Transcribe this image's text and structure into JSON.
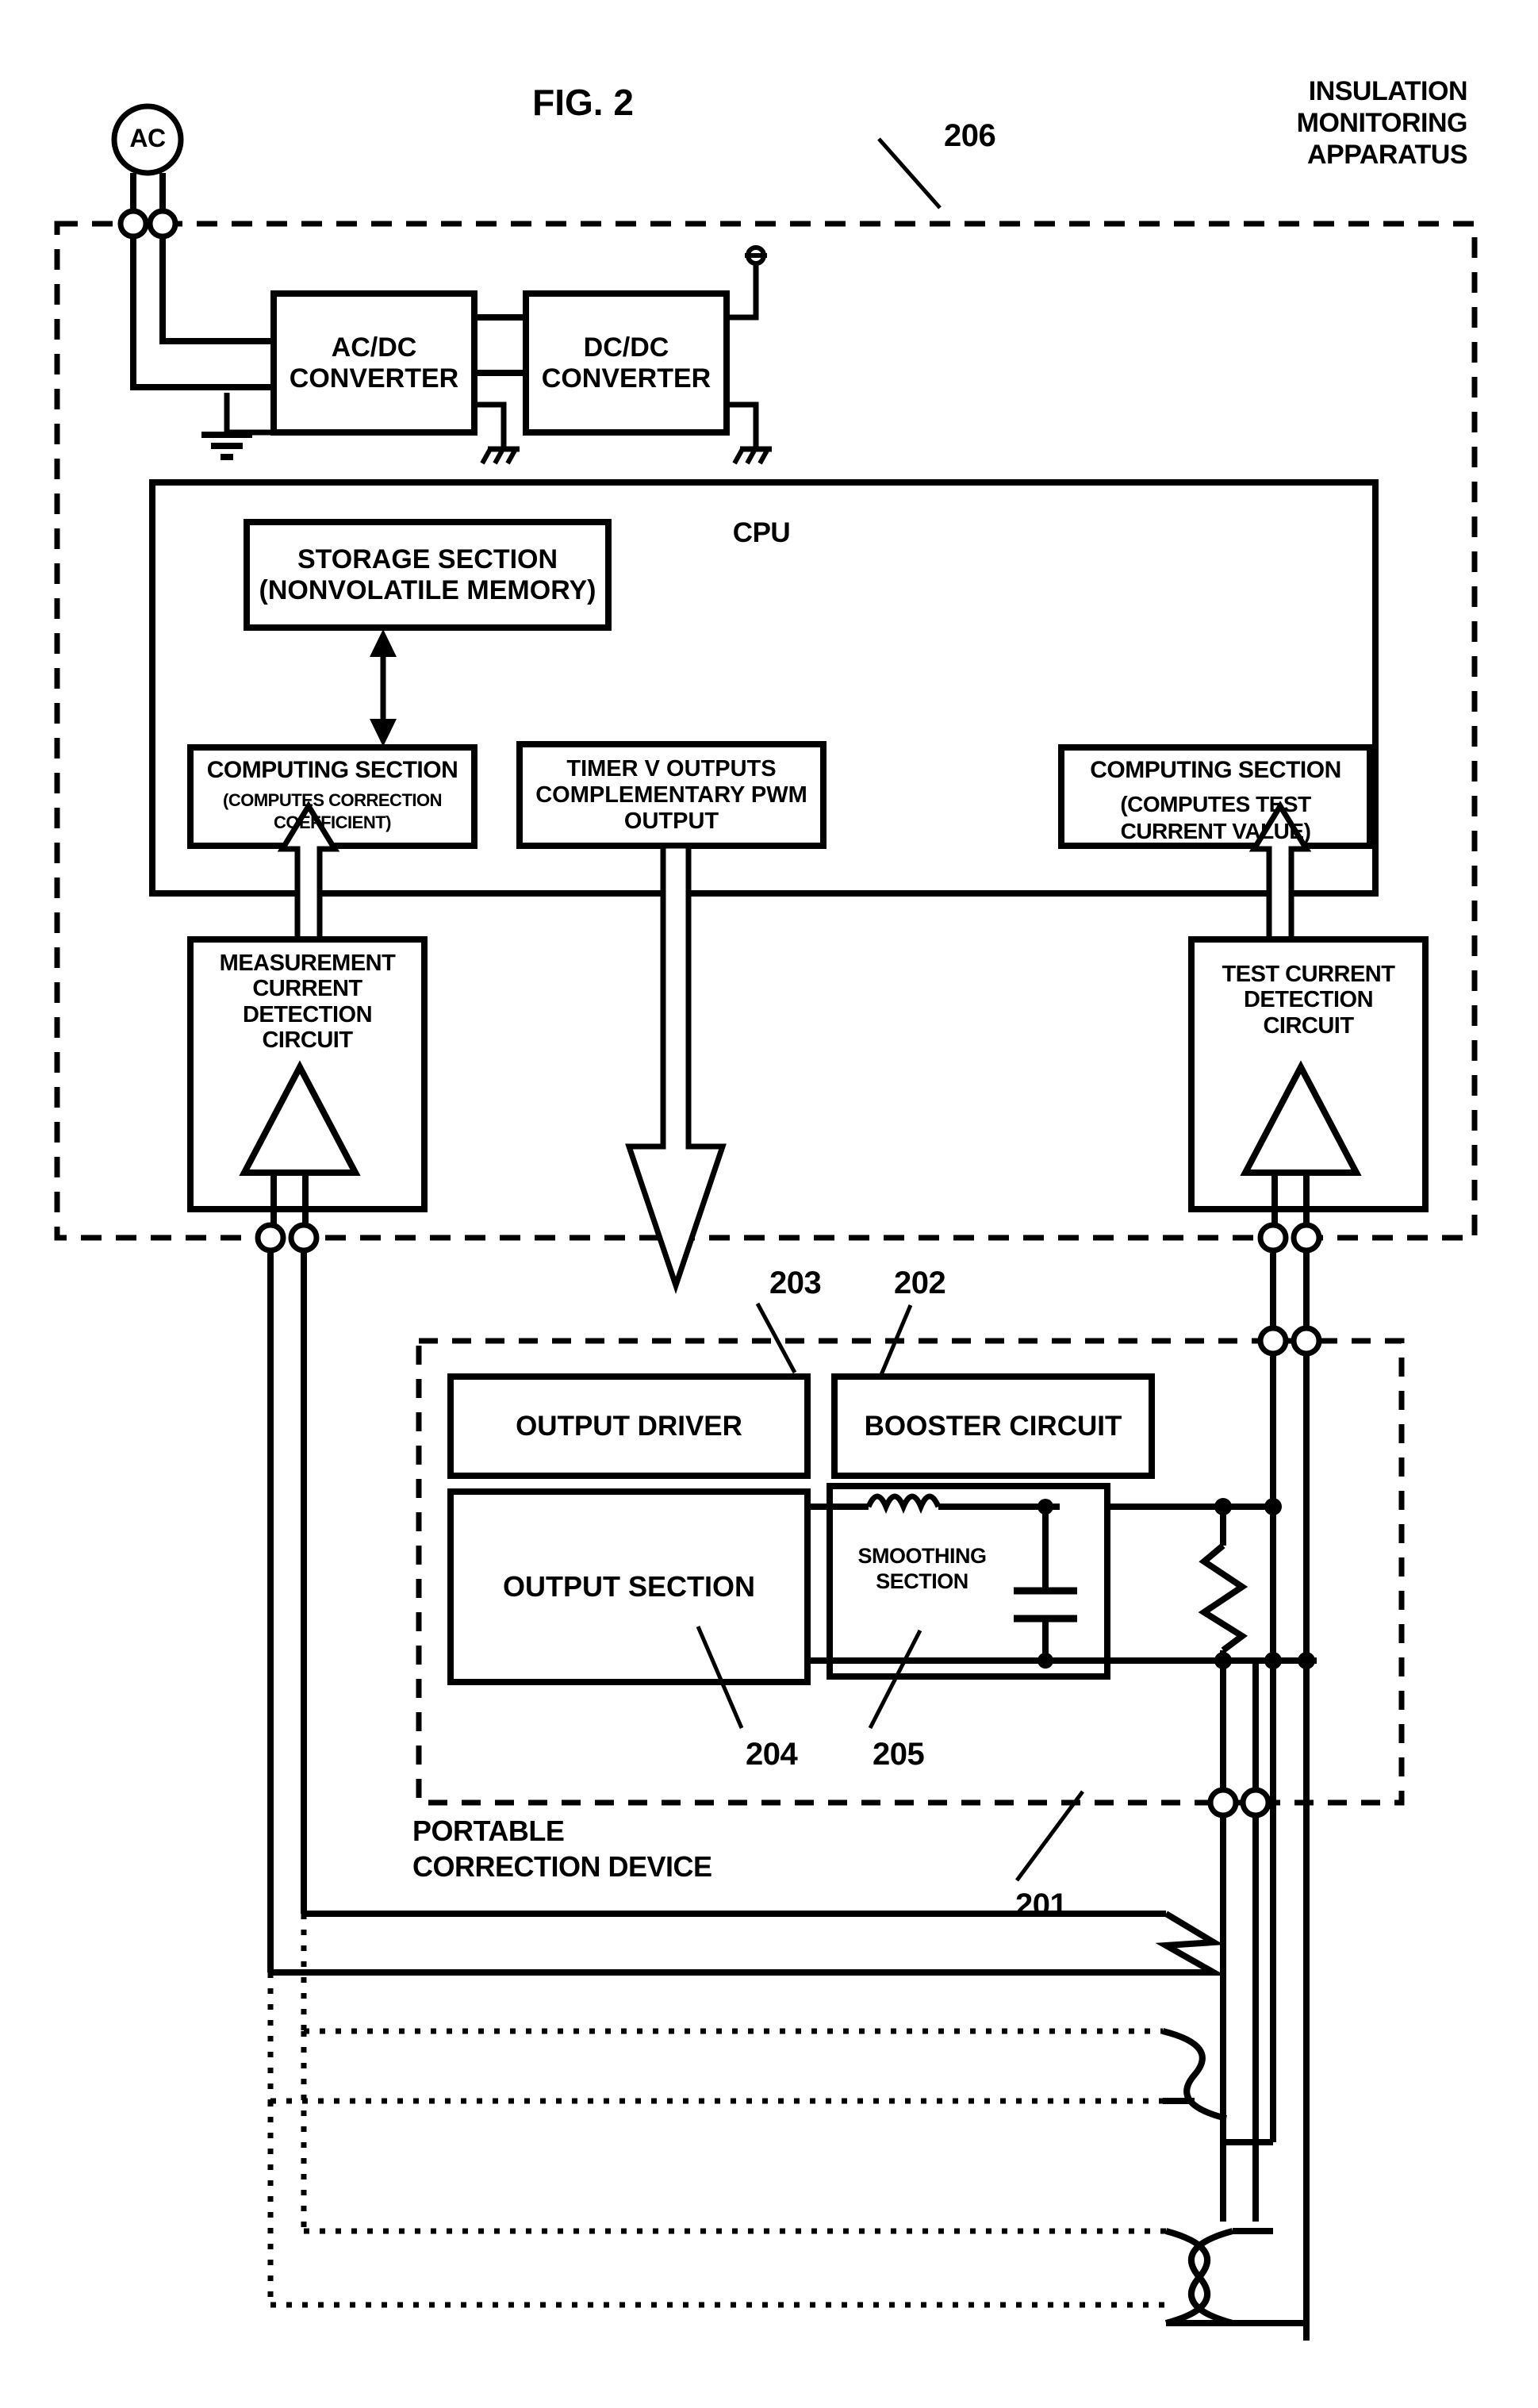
{
  "figure": {
    "title": "FIG. 2",
    "apparatus_label": "INSULATION\nMONITORING\nAPPARATUS",
    "device_label": "PORTABLE\nCORRECTION DEVICE"
  },
  "reference_numerals": {
    "apparatus": "206",
    "device": "201",
    "booster": "202",
    "output_driver": "203",
    "output_section": "204",
    "smoothing_section": "205"
  },
  "source": {
    "ac_label": "AC"
  },
  "blocks": {
    "ac_dc_converter": "AC/DC\nCONVERTER",
    "dc_dc_converter": "DC/DC\nCONVERTER",
    "cpu": "CPU",
    "storage_section": "STORAGE SECTION\n(NONVOLATILE\nMEMORY)",
    "computing_correction_main": "COMPUTING SECTION",
    "computing_correction_sub": "(COMPUTES CORRECTION\nCOEFFICIENT)",
    "timer": "TIMER V\nOUTPUTS\nCOMPLEMENTARY\nPWM OUTPUT",
    "computing_test_main": "COMPUTING SECTION",
    "computing_test_sub": "(COMPUTES TEST\nCURRENT VALUE)",
    "measurement_detection": "MEASUREMENT\nCURRENT\nDETECTION\nCIRCUIT",
    "test_detection": "TEST CURRENT\nDETECTION\nCIRCUIT",
    "output_driver": "OUTPUT DRIVER",
    "booster_circuit": "BOOSTER\nCIRCUIT",
    "output_section": "OUTPUT\nSECTION",
    "smoothing_section": "SMOOTHING\nSECTION"
  },
  "colors": {
    "ink": "#000000",
    "paper": "#ffffff"
  }
}
